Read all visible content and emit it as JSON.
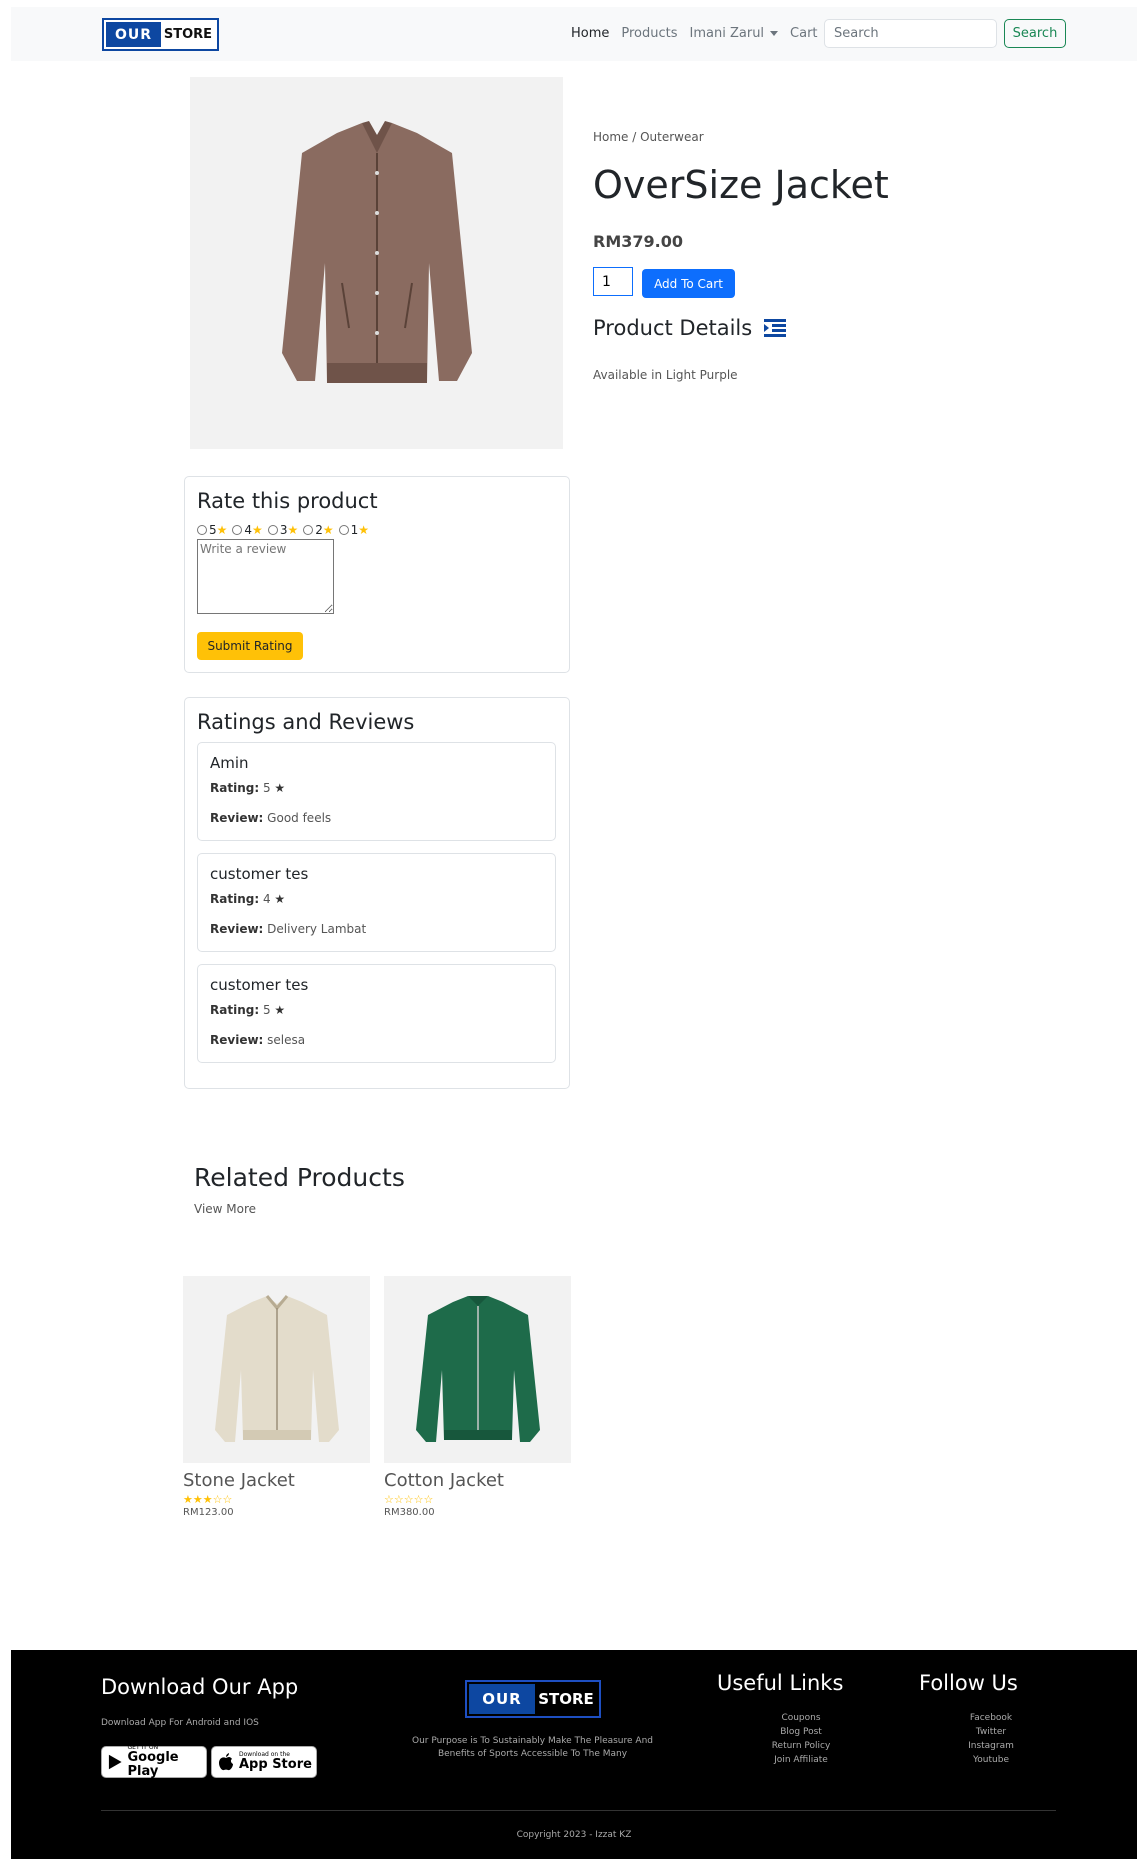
{
  "brand": {
    "part1": "OUR",
    "part2": "STORE"
  },
  "nav": {
    "links": [
      {
        "label": "Home"
      },
      {
        "label": "Products"
      },
      {
        "label": "Imani Zarul"
      },
      {
        "label": "Cart"
      }
    ],
    "search_placeholder": "Search",
    "search_button": "Search"
  },
  "product": {
    "breadcrumb_home": "Home",
    "breadcrumb_sep": " / ",
    "breadcrumb_category": "Outerwear",
    "title": "OverSize Jacket",
    "price": "RM379.00",
    "quantity": "1",
    "add_to_cart": "Add To Cart",
    "details_heading": "Product Details",
    "details_text": "Available in Light Purple",
    "image_color": "#8a6b60"
  },
  "rate": {
    "title": "Rate this product",
    "options": [
      "5",
      "4",
      "3",
      "2",
      "1"
    ],
    "review_placeholder": "Write a review",
    "submit": "Submit Rating"
  },
  "reviews": {
    "title": "Ratings and Reviews",
    "rating_label": "Rating:",
    "review_label": "Review:",
    "items": [
      {
        "name": "Amin",
        "rating": "5",
        "review": "Good feels"
      },
      {
        "name": "customer tes",
        "rating": "4",
        "review": "Delivery Lambat"
      },
      {
        "name": "customer tes",
        "rating": "5",
        "review": "selesa"
      }
    ]
  },
  "related": {
    "title": "Related Products",
    "view_more": "View More",
    "items": [
      {
        "name": "Stone Jacket",
        "price": "RM123.00",
        "stars": 3,
        "color": "#e3dccb"
      },
      {
        "name": "Cotton Jacket",
        "price": "RM380.00",
        "stars": 0,
        "color": "#1e6b4a"
      }
    ]
  },
  "footer": {
    "app_title": "Download Our App",
    "app_sub": "Download App For Android and IOS",
    "google_small": "GET IT ON",
    "google_big": "Google Play",
    "apple_small": "Download on the",
    "apple_big": "App Store",
    "purpose": "Our Purpose is To Sustainably Make The Pleasure And Benefits of Sports Accessible To The Many",
    "useful_title": "Useful Links",
    "useful_links": [
      "Coupons",
      "Blog Post",
      "Return Policy",
      "Join Affiliate"
    ],
    "follow_title": "Follow Us",
    "follow_links": [
      "Facebook",
      "Twitter",
      "Instagram",
      "Youtube"
    ],
    "copyright": "Copyright 2023 - Izzat KZ"
  },
  "colors": {
    "primary": "#0d6efd",
    "success": "#198754",
    "warning": "#ffc107",
    "brand_blue": "#0d47a1"
  }
}
